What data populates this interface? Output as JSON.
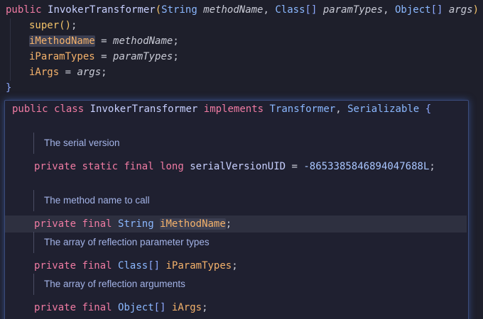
{
  "editor": {
    "line1": {
      "kw_public": "public",
      "ctor_name": "InvokerTransformer",
      "paren_open": "(",
      "t_string": "String",
      "p_methodName": "methodName",
      "comma1": ",",
      "t_class": "Class",
      "arr1": "[]",
      "p_paramTypes": "paramTypes",
      "comma2": ",",
      "t_object": "Object",
      "arr2": "[]",
      "p_args": "args",
      "paren_close": ")",
      "brace_open": "{"
    },
    "line2": {
      "super_call": "super",
      "parens": "()",
      "semi": ";"
    },
    "line3": {
      "field": "iMethodName",
      "assign": " = ",
      "value": "methodName",
      "semi": ";"
    },
    "line4": {
      "field": "iParamTypes",
      "assign": " = ",
      "value": "paramTypes",
      "semi": ";"
    },
    "line5": {
      "field": "iArgs",
      "assign": " = ",
      "value": "args",
      "semi": ";"
    },
    "line6": {
      "brace_close": "}"
    }
  },
  "popup": {
    "class_decl": {
      "kw_public": "public",
      "kw_class": "class",
      "class_name": "InvokerTransformer",
      "kw_implements": "implements",
      "iface1": "Transformer",
      "comma": ",",
      "iface2": "Serializable",
      "brace": "{"
    },
    "doc1": "The serial version",
    "field1": {
      "kw_private": "private",
      "kw_static": "static",
      "kw_final": "final",
      "type": "long",
      "name": "serialVersionUID",
      "assign": " = ",
      "value": "-8653385846894047688L",
      "semi": ";"
    },
    "doc2": "The method name to call",
    "field2": {
      "kw_private": "private",
      "kw_final": "final",
      "type": "String",
      "name": "iMethodName",
      "semi": ";"
    },
    "doc3": "The array of reflection parameter types",
    "field3": {
      "kw_private": "private",
      "kw_final": "final",
      "type": "Class",
      "arr": "[]",
      "name": "iParamTypes",
      "semi": ";"
    },
    "doc4": "The array of reflection arguments",
    "field4": {
      "kw_private": "private",
      "kw_final": "final",
      "type": "Object",
      "arr": "[]",
      "name": "iArgs",
      "semi": ";"
    }
  }
}
